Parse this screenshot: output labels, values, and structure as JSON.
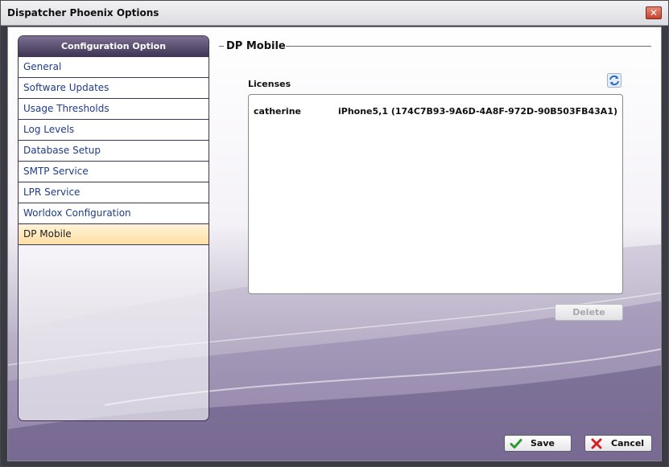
{
  "window": {
    "title": "Dispatcher Phoenix Options",
    "close_glyph": "✕"
  },
  "sidebar": {
    "header": "Configuration Option",
    "items": [
      {
        "label": "General",
        "selected": false
      },
      {
        "label": "Software Updates",
        "selected": false
      },
      {
        "label": "Usage Thresholds",
        "selected": false
      },
      {
        "label": "Log Levels",
        "selected": false
      },
      {
        "label": "Database Setup",
        "selected": false
      },
      {
        "label": "SMTP Service",
        "selected": false
      },
      {
        "label": "LPR Service",
        "selected": false
      },
      {
        "label": "Worldox Configuration",
        "selected": false
      },
      {
        "label": "DP Mobile",
        "selected": true
      }
    ]
  },
  "main": {
    "section_title": "DP Mobile",
    "licenses_label": "Licenses",
    "licenses": [
      {
        "user": "catherine",
        "device": "iPhone5,1 (174C7B93-9A6D-4A8F-972D-90B503FB43A1)"
      }
    ],
    "delete_label": "Delete",
    "delete_enabled": false
  },
  "footer": {
    "save_label": "Save",
    "cancel_label": "Cancel"
  },
  "icons": {
    "refresh": "refresh-icon",
    "save": "checkmark-icon",
    "cancel": "x-icon",
    "close": "close-icon"
  },
  "colors": {
    "accent_selected": "#ffdfa4",
    "link_text": "#1f3c88",
    "sidebar_header": "#3e3452"
  }
}
